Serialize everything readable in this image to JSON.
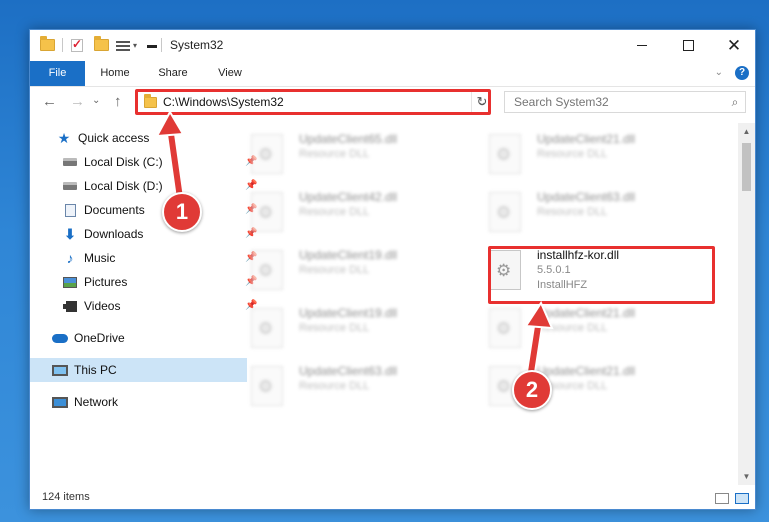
{
  "window": {
    "title": "System32",
    "minimize": "",
    "maximize": "",
    "close": "✕"
  },
  "ribbon": {
    "tabs": [
      "File",
      "Home",
      "Share",
      "View"
    ],
    "help": "?"
  },
  "nav": {
    "back": "←",
    "forward": "→",
    "recent": "⌄",
    "up": "↑",
    "address": "C:\\Windows\\System32",
    "refresh": "↻",
    "search_placeholder": "Search System32"
  },
  "sidebar": {
    "items": [
      {
        "label": "Quick access",
        "icon": "star-icon",
        "pinned": false
      },
      {
        "label": "Local Disk (C:)",
        "icon": "drive-icon",
        "pinned": true
      },
      {
        "label": "Local Disk (D:)",
        "icon": "drive-icon",
        "pinned": true
      },
      {
        "label": "Documents",
        "icon": "documents-icon",
        "pinned": true
      },
      {
        "label": "Downloads",
        "icon": "download-icon",
        "pinned": true
      },
      {
        "label": "Music",
        "icon": "music-icon",
        "pinned": true
      },
      {
        "label": "Pictures",
        "icon": "pictures-icon",
        "pinned": true
      },
      {
        "label": "Videos",
        "icon": "videos-icon",
        "pinned": true
      },
      {
        "label": "OneDrive",
        "icon": "onedrive-icon",
        "pinned": false
      },
      {
        "label": "This PC",
        "icon": "this-pc-icon",
        "pinned": false,
        "selected": true
      },
      {
        "label": "Network",
        "icon": "network-icon",
        "pinned": false
      }
    ]
  },
  "files": [
    {
      "name": "UpdateClient65.dll",
      "type": "Resource DLL"
    },
    {
      "name": "UpdateClient21.dll",
      "type": "Resource DLL"
    },
    {
      "name": "UpdateClient42.dll",
      "type": "Resource DLL"
    },
    {
      "name": "UpdateClient63.dll",
      "type": "Resource DLL"
    },
    {
      "name": "UpdateClient19.dll",
      "type": "Resource DLL"
    },
    {
      "name": "installhfz-kor.dll",
      "version": "5.5.0.1",
      "type": "InstallHFZ",
      "highlighted": true
    },
    {
      "name": "UpdateClient19.dll",
      "type": "Resource DLL"
    },
    {
      "name": "UpdateClient21.dll",
      "type": "Resource DLL"
    },
    {
      "name": "UpdateClient63.dll",
      "type": "Resource DLL"
    },
    {
      "name": "UpdateClient21.dll",
      "type": "Resource DLL"
    }
  ],
  "status": {
    "item_count": "124 items"
  },
  "annotations": {
    "step1": "1",
    "step2": "2",
    "color": "#e03a36"
  }
}
